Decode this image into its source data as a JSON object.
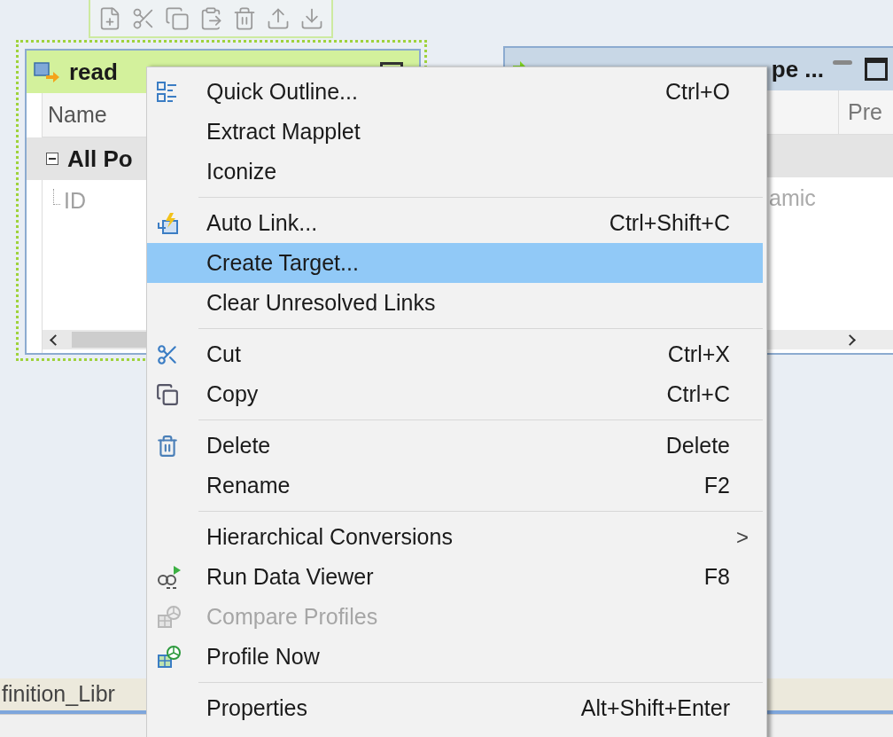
{
  "read_node": {
    "title": "read",
    "columns": [
      "Name"
    ],
    "rows": [
      {
        "kind": "group",
        "name": "All Po",
        "expanded": true
      },
      {
        "kind": "port",
        "name": "ID"
      }
    ]
  },
  "target_node": {
    "title": "pe ...",
    "columns": [
      "Pre"
    ],
    "cells": [
      "amic"
    ]
  },
  "bottom_tab": {
    "label": "finition_Libr"
  },
  "context_menu": [
    {
      "kind": "item",
      "label": "Quick Outline...",
      "shortcut": "Ctrl+O",
      "selected": false,
      "disabled": false
    },
    {
      "kind": "item",
      "label": "Extract Mapplet",
      "selected": false,
      "disabled": false
    },
    {
      "kind": "item",
      "label": "Iconize",
      "selected": false,
      "disabled": false
    },
    {
      "kind": "separator"
    },
    {
      "kind": "item",
      "label": "Auto Link...",
      "shortcut": "Ctrl+Shift+C",
      "selected": false,
      "disabled": false
    },
    {
      "kind": "item",
      "label": "Create Target...",
      "selected": true,
      "disabled": false
    },
    {
      "kind": "item",
      "label": "Clear Unresolved Links",
      "selected": false,
      "disabled": false
    },
    {
      "kind": "separator"
    },
    {
      "kind": "item",
      "label": "Cut",
      "shortcut": "Ctrl+X",
      "selected": false,
      "disabled": false
    },
    {
      "kind": "item",
      "label": "Copy",
      "shortcut": "Ctrl+C",
      "selected": false,
      "disabled": false
    },
    {
      "kind": "separator"
    },
    {
      "kind": "item",
      "label": "Delete",
      "shortcut": "Delete",
      "selected": false,
      "disabled": false
    },
    {
      "kind": "item",
      "label": "Rename",
      "shortcut": "F2",
      "selected": false,
      "disabled": false
    },
    {
      "kind": "separator"
    },
    {
      "kind": "submenu",
      "label": "Hierarchical Conversions",
      "arrow": ">",
      "selected": false,
      "disabled": false
    },
    {
      "kind": "item",
      "label": "Run Data Viewer",
      "shortcut": "F8",
      "selected": false,
      "disabled": false
    },
    {
      "kind": "item",
      "label": "Compare Profiles",
      "selected": false,
      "disabled": true
    },
    {
      "kind": "item",
      "label": "Profile Now",
      "selected": false,
      "disabled": false
    },
    {
      "kind": "separator"
    },
    {
      "kind": "item",
      "label": "Properties",
      "shortcut": "Alt+Shift+Enter",
      "selected": false,
      "disabled": false
    }
  ]
}
